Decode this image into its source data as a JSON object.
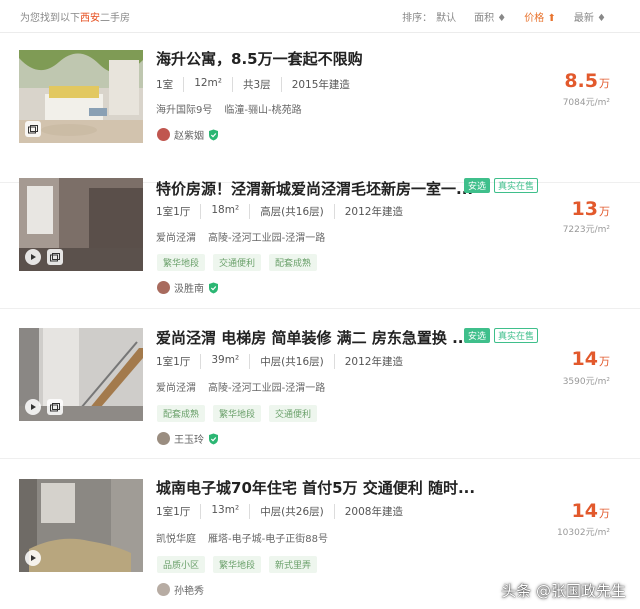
{
  "header": {
    "found_prefix": "为您找到以下",
    "city": "西安",
    "found_suffix": "二手房",
    "sort": {
      "label": "排序：",
      "default": "默认",
      "area": "面积 ♦",
      "price": "价格 ⬆",
      "latest": "最新 ♦"
    }
  },
  "listings": [
    {
      "title": "海升公寓，8.5万一套起不限购",
      "room": "1室",
      "area": "12m²",
      "floor": "共3层",
      "year": "2015年建造",
      "community": "海升国际9号",
      "district": "临潼-骊山-桃苑路",
      "agent": "赵紫姻",
      "price": "8.5",
      "price_unit": "万",
      "unit_price": "7084元/m²"
    },
    {
      "title": "特价房源！泾渭新城爱尚泾渭毛坯新房一室一...",
      "tag_a": "安选",
      "tag_b": "真实在售",
      "room": "1室1厅",
      "area": "18m²",
      "floor": "高层(共16层)",
      "year": "2012年建造",
      "community": "爱尚泾渭",
      "district": "高陵-泾河工业园-泾渭一路",
      "features": [
        "繁华地段",
        "交通便利",
        "配套成熟"
      ],
      "agent": "汲胜南",
      "price": "13",
      "price_unit": "万",
      "unit_price": "7223元/m²"
    },
    {
      "title": "爱尚泾渭 电梯房 简单装修 满二 房东急置换 ...",
      "tag_a": "安选",
      "tag_b": "真实在售",
      "room": "1室1厅",
      "area": "39m²",
      "floor": "中层(共16层)",
      "year": "2012年建造",
      "community": "爱尚泾渭",
      "district": "高陵-泾河工业园-泾渭一路",
      "features": [
        "配套成熟",
        "繁华地段",
        "交通便利"
      ],
      "agent": "王玉玲",
      "price": "14",
      "price_unit": "万",
      "unit_price": "3590元/m²"
    },
    {
      "title": "城南电子城70年住宅 首付5万 交通便利 随时...",
      "room": "1室1厅",
      "area": "13m²",
      "floor": "中层(共26层)",
      "year": "2008年建造",
      "community": "凯悦华庭",
      "district": "雁塔-电子城-电子正街88号",
      "features": [
        "品质小区",
        "繁华地段",
        "新式里弄"
      ],
      "agent": "孙艳秀",
      "price": "14",
      "price_unit": "万",
      "unit_price": "10302元/m²"
    }
  ],
  "watermark": "头条 @张国政先生",
  "colors": {
    "accent": "#e2592c",
    "tag_green": "#3fbf8b"
  }
}
